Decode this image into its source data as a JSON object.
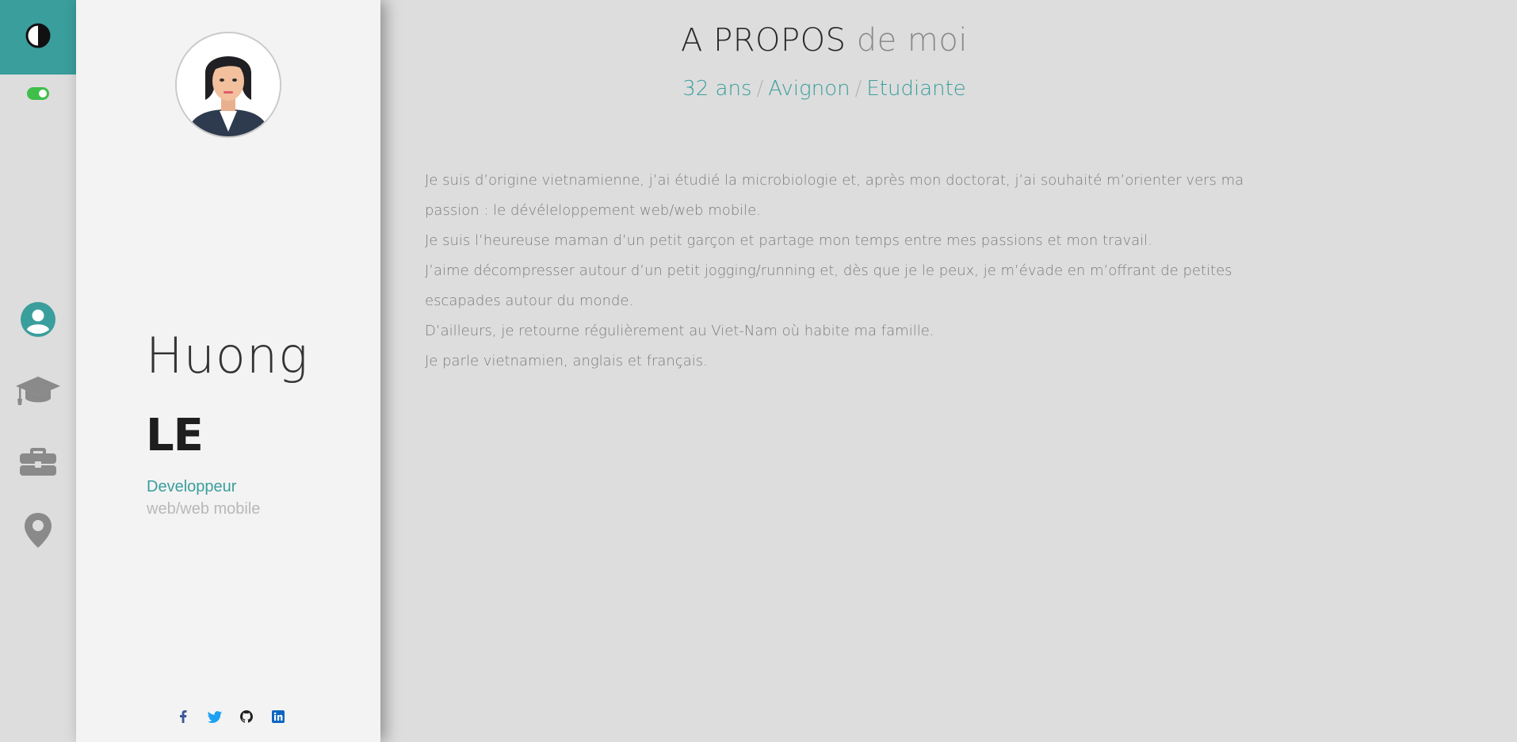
{
  "nav": {
    "theme_icon": "contrast-icon",
    "toggle_icon": "toggle-switch",
    "items": [
      {
        "icon": "user-icon",
        "active": true
      },
      {
        "icon": "graduation-cap-icon",
        "active": false
      },
      {
        "icon": "briefcase-icon",
        "active": false
      },
      {
        "icon": "map-pin-icon",
        "active": false
      }
    ],
    "accent_color": "#3a9e9c",
    "toggle_color": "#3fbf4a"
  },
  "profile": {
    "avatar_icon": "avatar-portrait",
    "first_name": "Huong",
    "last_name": "LE",
    "role": "Developpeur",
    "role_sub": "web/web mobile",
    "socials": [
      {
        "icon": "facebook-icon",
        "color": "#3b5998"
      },
      {
        "icon": "twitter-icon",
        "color": "#1da1f2"
      },
      {
        "icon": "github-icon",
        "color": "#222222"
      },
      {
        "icon": "linkedin-icon",
        "color": "#0a66c2"
      }
    ]
  },
  "about": {
    "title_main": "A PROPOS",
    "title_light": "de moi",
    "age": "32 ans",
    "city": "Avignon",
    "status": "Etudiante",
    "separator": "/",
    "paragraphs": [
      "Je suis d’origine vietnamienne, j’ai étudié la microbiologie et, après mon doctorat, j’ai souhaité m’orienter vers ma passion : le dévéleloppement web/web mobile.",
      "Je suis l’heureuse maman d’un petit garçon et partage mon temps entre mes passions et mon travail.",
      "J’aime décompresser autour d’un petit jogging/running et, dès que je le peux, je m’évade en m’offrant de petites escapades autour du monde.",
      "D’ailleurs, je retourne régulièrement au Viet-Nam où habite ma famille.",
      "Je parle vietnamien, anglais et français."
    ]
  }
}
